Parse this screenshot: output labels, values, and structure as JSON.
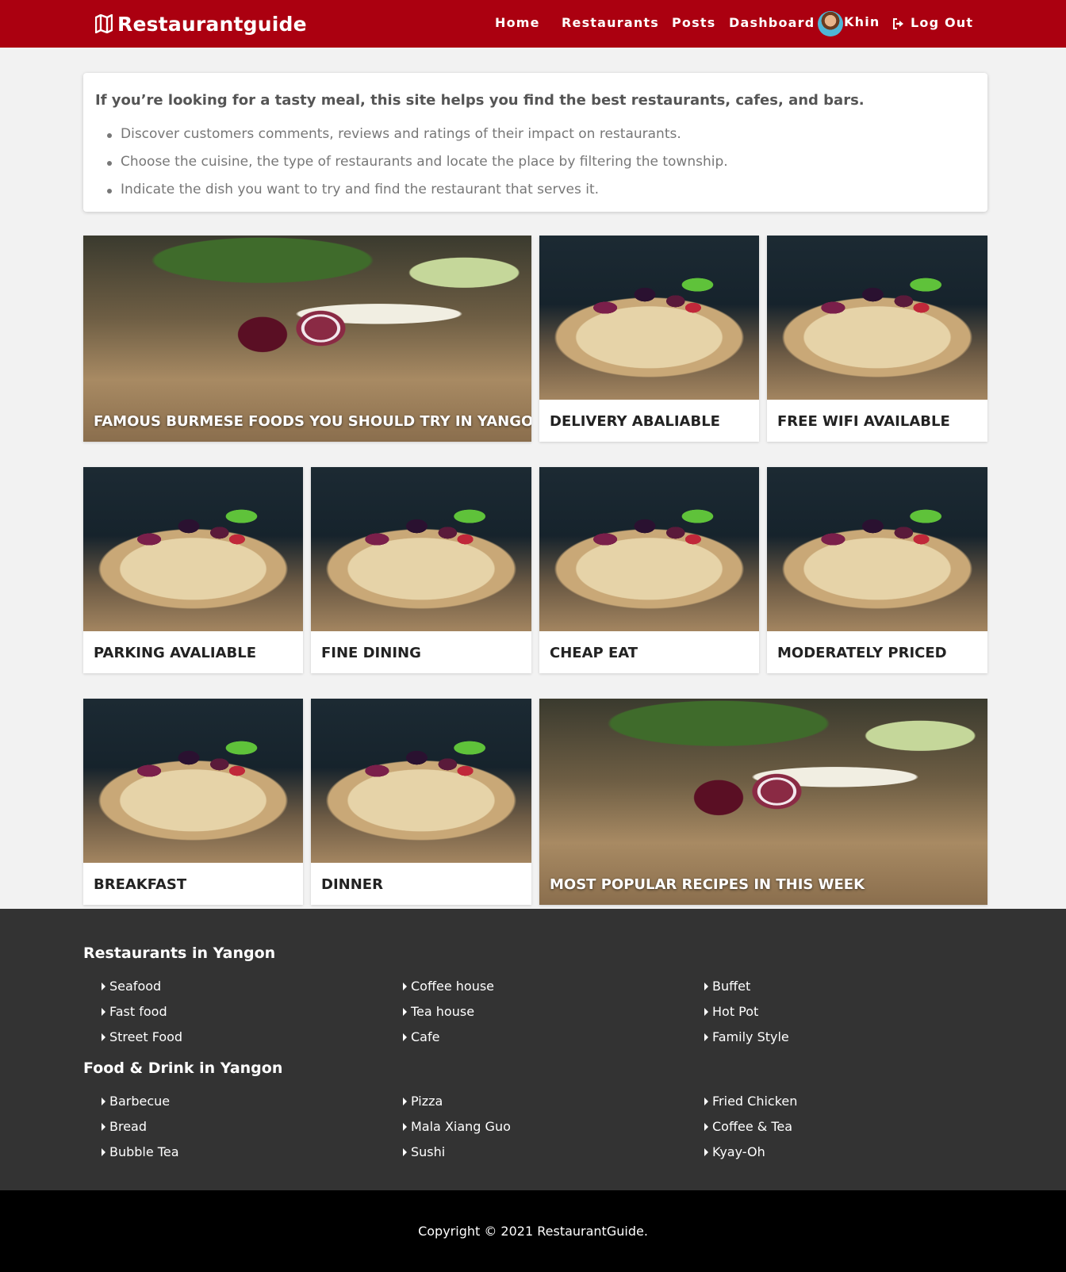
{
  "header": {
    "brand": "Restaurantguide",
    "nav": {
      "home": "Home",
      "restaurants": "Restaurants",
      "posts": "Posts",
      "dashboard": "Dashboard",
      "user": "Khin",
      "logout": "Log Out"
    },
    "accent_color": "#ab0010"
  },
  "intro": {
    "title": "If you’re looking for a tasty meal, this site helps you find the best restaurants, cafes, and bars.",
    "bullets": [
      "Discover customers comments, reviews and ratings of their impact on restaurants.",
      "Choose the cuisine, the type of restaurants and locate the place by filtering the township.",
      "Indicate the dish you want to try and find the restaurant that serves it."
    ]
  },
  "cards": [
    "Famous Burmese Foods You Should Try In Yangon",
    "Delivery Abaliable",
    "Free Wifi Available",
    "Parking Avaliable",
    "Fine Dining",
    "Cheap Eat",
    "Moderately Priced",
    "Breakfast",
    "Dinner",
    "Most Popular Recipes In This Week"
  ],
  "footer": {
    "restaurants_heading": "Restaurants in Yangon",
    "restaurants": [
      "Seafood",
      "Coffee house",
      "Buffet",
      "Fast food",
      "Tea house",
      "Hot Pot",
      "Street Food",
      "Cafe",
      "Family Style"
    ],
    "food_heading": "Food & Drink in Yangon",
    "food": [
      "Barbecue",
      "Pizza",
      "Fried Chicken",
      "Bread",
      "Mala Xiang Guo",
      "Coffee & Tea",
      "Bubble Tea",
      "Sushi",
      "Kyay-Oh"
    ],
    "copyright": "Copyright © 2021 RestaurantGuide."
  }
}
